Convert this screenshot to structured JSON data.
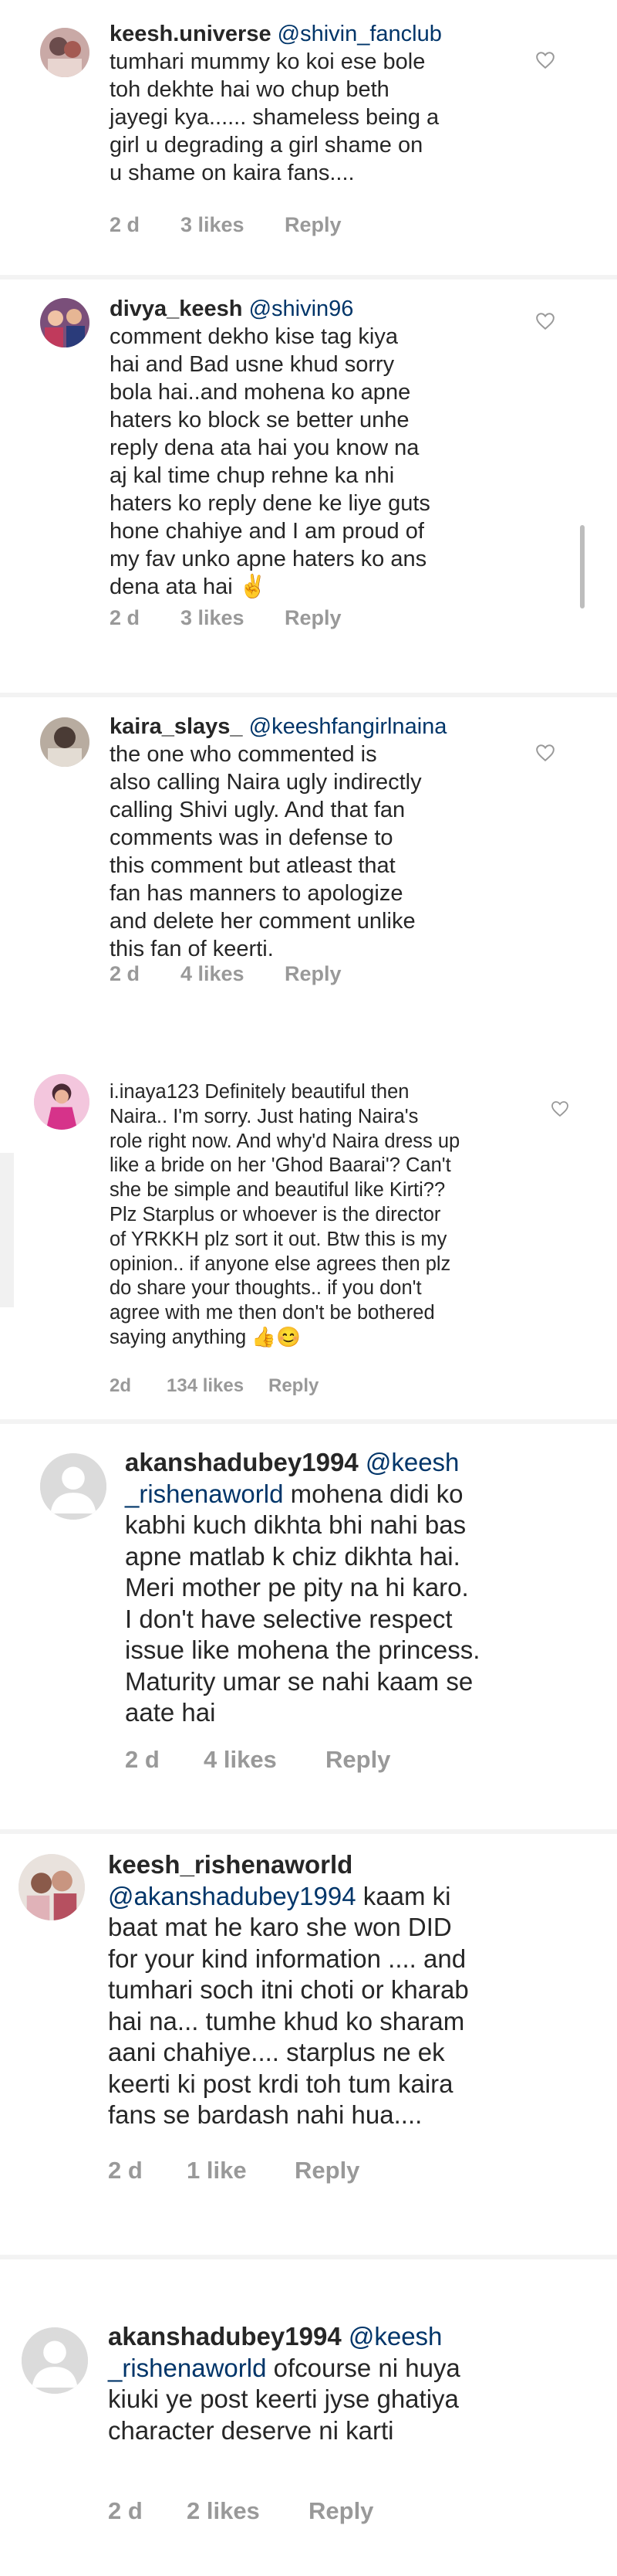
{
  "comments": [
    {
      "username": "keesh.universe",
      "mention": "@shivin_fanclub",
      "text": "tumhari mummy ko koi ese bole\ntoh dekhte hai wo chup beth\njayegi kya...... shameless being a\ngirl u degrading a girl shame on\nu shame on kaira fans....",
      "time": "2 d",
      "likes": "3 likes",
      "reply": "Reply"
    },
    {
      "username": "divya_keesh",
      "mention": "@shivin96",
      "text": "comment dekho kise tag kiya\nhai and Bad usne khud sorry\nbola hai..and mohena ko apne\nhaters ko block se better unhe\nreply dena ata hai you know na\naj kal time chup rehne ka nhi\nhaters ko reply dene ke liye guts\nhone chahiye and I am proud of\nmy fav unko apne haters ko ans\ndena ata hai ✌",
      "time": "2 d",
      "likes": "3 likes",
      "reply": "Reply"
    },
    {
      "username": "kaira_slays_",
      "mention": "@keeshfangirlnaina",
      "text": "the one who commented is\nalso calling Naira ugly indirectly\ncalling Shivi ugly. And that fan\ncomments was in defense to\nthis comment but atleast that\nfan has manners to apologize\nand delete her comment unlike\nthis fan of keerti.",
      "time": "2 d",
      "likes": "4 likes",
      "reply": "Reply"
    },
    {
      "username": "i.inaya123",
      "mention": "",
      "text": "Definitely beautiful then\nNaira.. I'm sorry.  Just hating Naira's\nrole right now. And why'd Naira dress up\nlike a bride on her 'Ghod Baarai'? Can't\nshe be simple and beautiful like Kirti??\nPlz Starplus or whoever is the director\nof YRKKH plz sort it out. Btw this is my\nopinion.. if anyone else agrees then plz\ndo share your thoughts.. if you don't\nagree with me then don't be bothered\nsaying anything 👍😊",
      "time": "2d",
      "likes": "134 likes",
      "reply": "Reply"
    },
    {
      "username": "akanshadubey1994",
      "mention": "@keesh\n_rishenaworld",
      "text": "mohena didi ko\nkabhi kuch dikhta bhi nahi bas\napne matlab k chiz dikhta hai.\nMeri mother pe pity na hi karo.\nI don't have selective respect\nissue like mohena the princess.\nMaturity umar se nahi kaam se\naate hai",
      "time": "2 d",
      "likes": "4 likes",
      "reply": "Reply"
    },
    {
      "username": "keesh_rishenaworld",
      "mention": "@akanshadubey1994",
      "text": "kaam ki\nbaat mat he  karo she won DID\nfor your kind information .... and\ntumhari soch itni choti or kharab\nhai na... tumhe khud ko sharam\naani chahiye.... starplus ne ek\nkeerti ki post krdi toh tum kaira\nfans se bardash nahi hua....",
      "time": "2 d",
      "likes": "1 like",
      "reply": "Reply"
    },
    {
      "username": "akanshadubey1994",
      "mention": "@keesh\n_rishenaworld",
      "text": "ofcourse ni huya\nkiuki ye post keerti jyse ghatiya\ncharacter deserve ni karti",
      "time": "2 d",
      "likes": "2 likes",
      "reply": "Reply"
    }
  ],
  "icons": {
    "heart": "heart-outline-icon",
    "default_avatar": "default-avatar-icon"
  },
  "colors": {
    "text": "#262626",
    "meta": "#999999",
    "mention": "#003569"
  }
}
